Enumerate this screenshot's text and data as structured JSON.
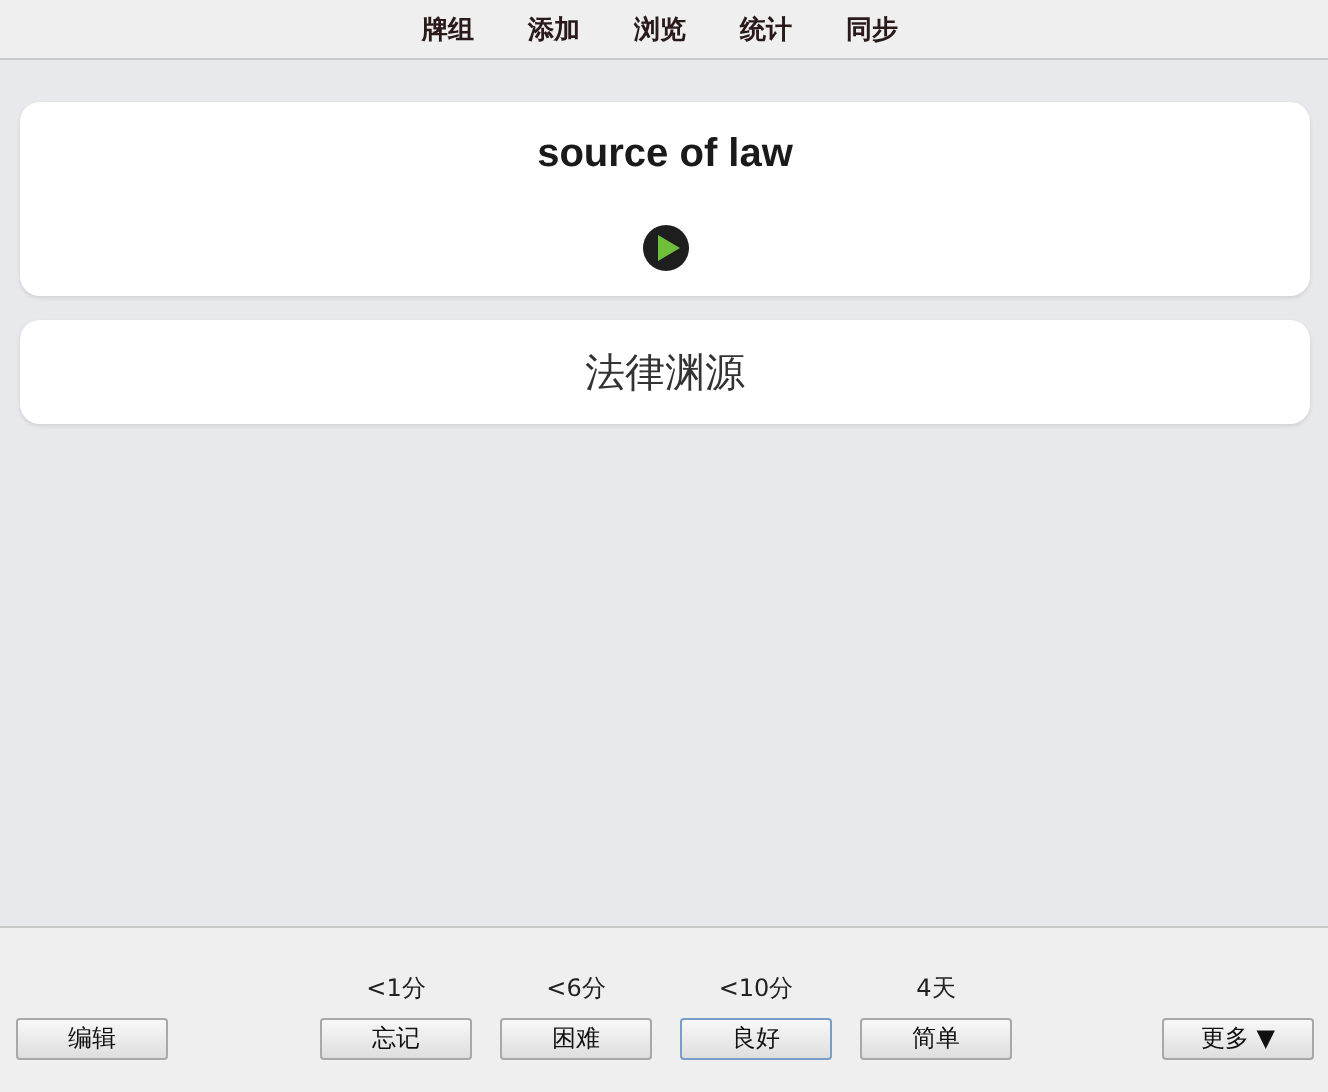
{
  "nav": [
    "牌组",
    "添加",
    "浏览",
    "统计",
    "同步"
  ],
  "question": {
    "text": "source of law"
  },
  "answer": {
    "text": "法律渊源"
  },
  "edit_button": "编辑",
  "answers": [
    {
      "interval": "<1分",
      "label": "忘记",
      "selected": false
    },
    {
      "interval": "<6分",
      "label": "困难",
      "selected": false
    },
    {
      "interval": "<10分",
      "label": "良好",
      "selected": true
    },
    {
      "interval": "4天",
      "label": "简单",
      "selected": false
    }
  ],
  "more_button": "更多 ▼"
}
